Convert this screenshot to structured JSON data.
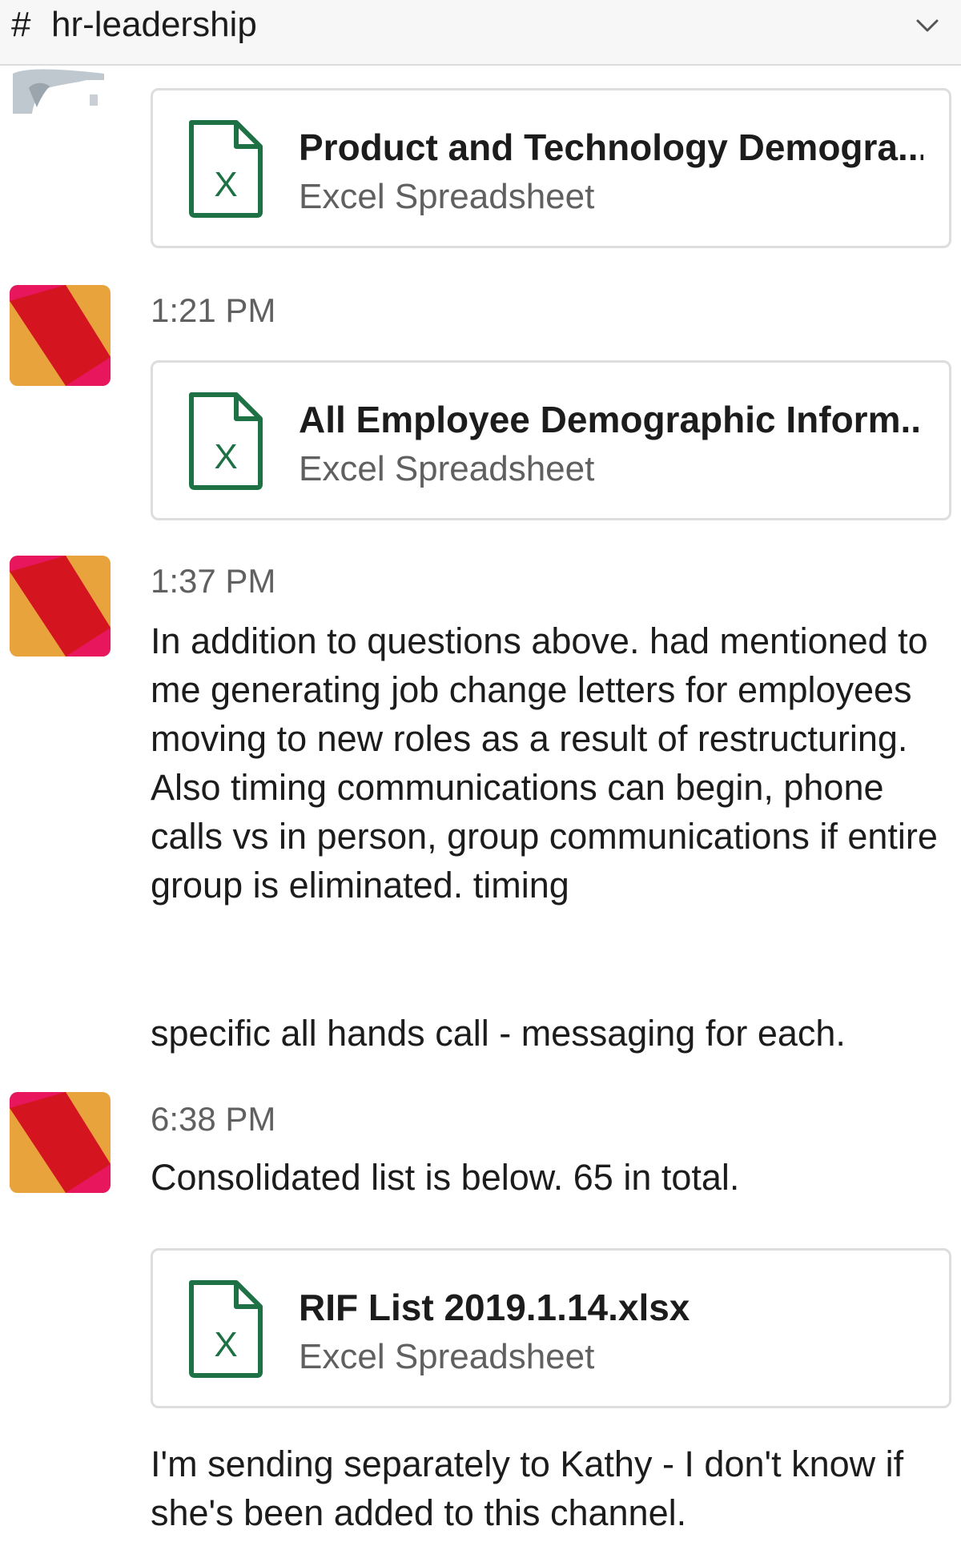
{
  "header": {
    "hash": "#",
    "channel_name": "hr-leadership"
  },
  "messages": [
    {
      "file": {
        "name": "Product and Technology Demogra...",
        "type": "Excel Spreadsheet",
        "icon": "excel-file-icon"
      }
    },
    {
      "time": "1:21 PM",
      "file": {
        "name": "All Employee Demographic Inform...",
        "type": "Excel Spreadsheet",
        "icon": "excel-file-icon"
      }
    },
    {
      "time": "1:37 PM",
      "text": "In addition to questions above. had mentioned to me generating job change letters for employees moving to new roles as a result of restructuring. Also timing communications can begin, phone calls vs in person, group communications if entire group is eliminated. timing",
      "text_tail": "specific all hands call - messaging for each."
    },
    {
      "time": "6:38 PM",
      "text": "Consolidated list is below. 65 in total.",
      "file": {
        "name": "RIF List 2019.1.14.xlsx",
        "type": "Excel Spreadsheet",
        "icon": "excel-file-icon"
      },
      "text_after": "I'm sending separately to Kathy - I don't know if she's been added to this channel."
    }
  ],
  "colors": {
    "excel_green": "#1e7145",
    "avatar_red": "#d4141f",
    "avatar_pink": "#e8175d",
    "avatar_orange": "#e8a33d",
    "meta_gray": "#616061"
  }
}
